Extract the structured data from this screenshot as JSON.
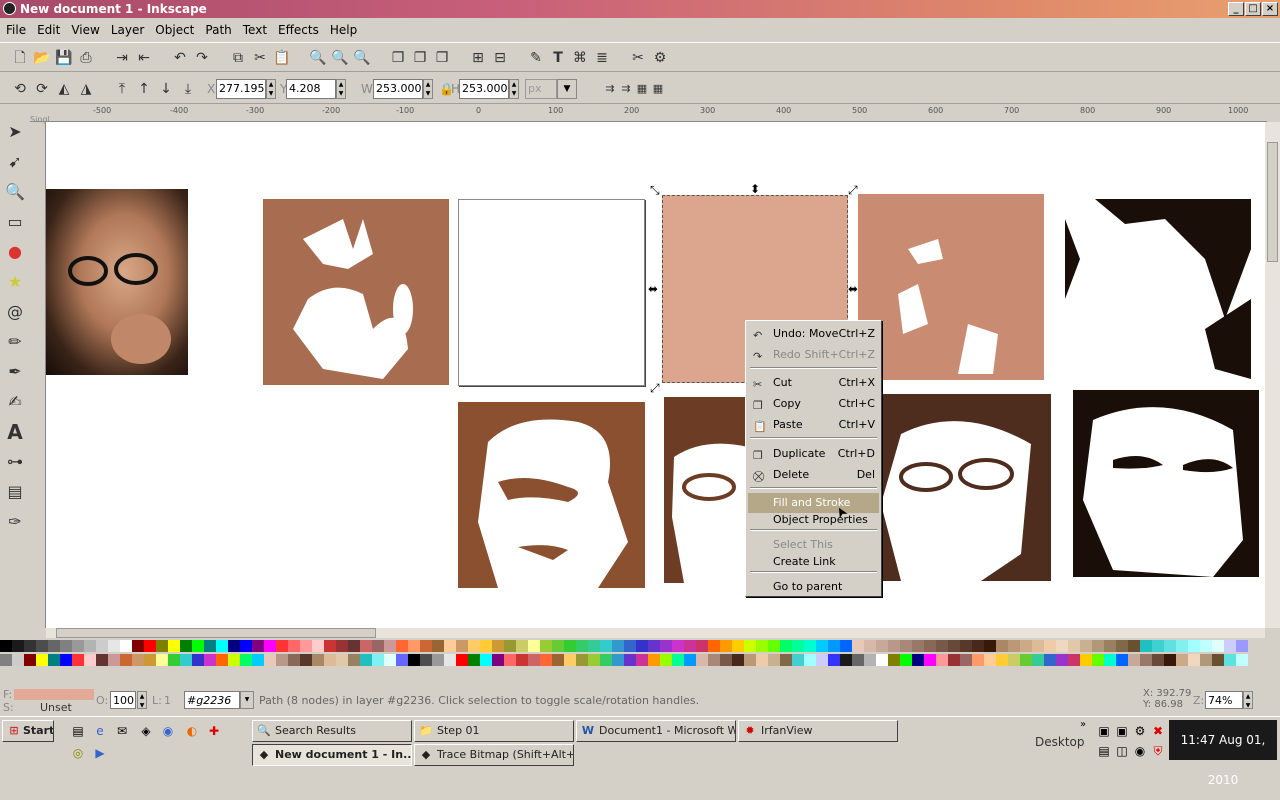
{
  "window": {
    "title": "New document 1 - Inkscape"
  },
  "menu": [
    "File",
    "Edit",
    "View",
    "Layer",
    "Object",
    "Path",
    "Text",
    "Effects",
    "Help"
  ],
  "coords": {
    "x_label": "X",
    "x_value": "277.195",
    "y_label": "Y",
    "y_value": "4.208",
    "w_label": "W",
    "w_value": "253.000",
    "h_label": "H",
    "h_value": "253.000",
    "unit": "px"
  },
  "ruler_ticks": [
    "-500",
    "-400",
    "-300",
    "-200",
    "-100",
    "0",
    "100",
    "200",
    "300",
    "400",
    "500",
    "600",
    "700",
    "800",
    "900",
    "1000"
  ],
  "canvas_label": "Singl",
  "context_menu": {
    "items": [
      {
        "label": "Undo: Move",
        "shortcut": "Ctrl+Z",
        "icon": "undo-icon",
        "disabled": false
      },
      {
        "label": "Redo",
        "shortcut": "Shift+Ctrl+Z",
        "icon": "redo-icon",
        "disabled": true
      },
      {
        "label": "Cut",
        "shortcut": "Ctrl+X",
        "icon": "scissors-icon",
        "disabled": false
      },
      {
        "label": "Copy",
        "shortcut": "Ctrl+C",
        "icon": "copy-icon",
        "disabled": false
      },
      {
        "label": "Paste",
        "shortcut": "Ctrl+V",
        "icon": "paste-icon",
        "disabled": false
      },
      {
        "label": "Duplicate",
        "shortcut": "Ctrl+D",
        "icon": "duplicate-icon",
        "disabled": false
      },
      {
        "label": "Delete",
        "shortcut": "Del",
        "icon": "delete-icon",
        "disabled": false
      },
      {
        "label": "Fill and Stroke",
        "shortcut": "",
        "icon": "",
        "disabled": false,
        "highlighted": true
      },
      {
        "label": "Object Properties",
        "shortcut": "",
        "icon": "",
        "disabled": false
      },
      {
        "label": "Select This",
        "shortcut": "",
        "icon": "",
        "disabled": true
      },
      {
        "label": "Create Link",
        "shortcut": "",
        "icon": "",
        "disabled": false
      },
      {
        "label": "Go to parent",
        "shortcut": "",
        "icon": "",
        "disabled": false
      }
    ]
  },
  "status": {
    "fill_label": "F:",
    "stroke_label": "S:",
    "stroke_value": "Unset",
    "opacity_label": "O:",
    "opacity_value": "100",
    "layer_label": "L:",
    "layer_value": "1",
    "layer_name": "#g2236",
    "message": "Path (8 nodes) in layer #g2236. Click selection to toggle scale/rotation handles.",
    "cursor_x": "X: 392.79",
    "cursor_y": "Y: 86.98",
    "zoom_label": "Z:",
    "zoom_value": "74%"
  },
  "taskbar": {
    "start_label": "Start",
    "tasks_row1": [
      "Search Results",
      "Step 01",
      "Document1 - Microsoft W...",
      "IrfanView"
    ],
    "tasks_row2": [
      "New document 1 - In...",
      "Trace Bitmap (Shift+Alt+B)"
    ],
    "desktop_label": "Desktop",
    "clock": "11:47  Aug 01, 2010"
  },
  "colors": {
    "fill_swatch": "#e2aa96",
    "brown_medium": "#a86c50",
    "brown_light": "#dba58e",
    "brown_salmon": "#c98c72",
    "brown_dark": "#8a5030",
    "brown_darker": "#6c3c24",
    "brown_darkest": "#4e2c1e",
    "near_black": "#1a0e08"
  }
}
